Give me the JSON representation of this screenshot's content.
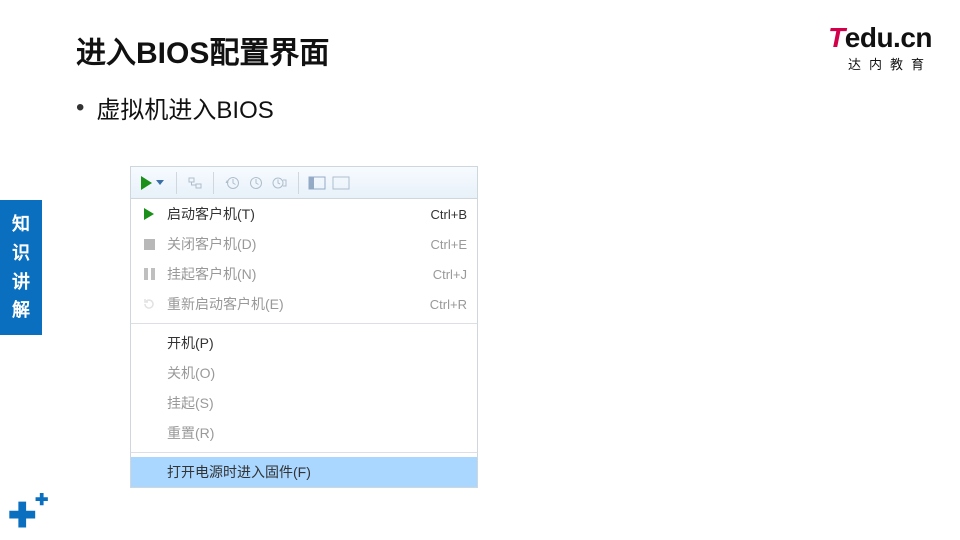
{
  "title": "进入BIOS配置界面",
  "bullet": "虚拟机进入BIOS",
  "logo": {
    "t": "T",
    "rest": "edu.cn",
    "sub": "达内教育"
  },
  "side_tab": "知\n识\n讲\n解",
  "menu": {
    "items": [
      {
        "label": "启动客户机(T)",
        "shortcut": "Ctrl+B"
      },
      {
        "label": "关闭客户机(D)",
        "shortcut": "Ctrl+E"
      },
      {
        "label": "挂起客户机(N)",
        "shortcut": "Ctrl+J"
      },
      {
        "label": "重新启动客户机(E)",
        "shortcut": "Ctrl+R"
      }
    ],
    "power": [
      {
        "label": "开机(P)"
      },
      {
        "label": "关机(O)"
      },
      {
        "label": "挂起(S)"
      },
      {
        "label": "重置(R)"
      }
    ],
    "firmware": "打开电源时进入固件(F)"
  }
}
